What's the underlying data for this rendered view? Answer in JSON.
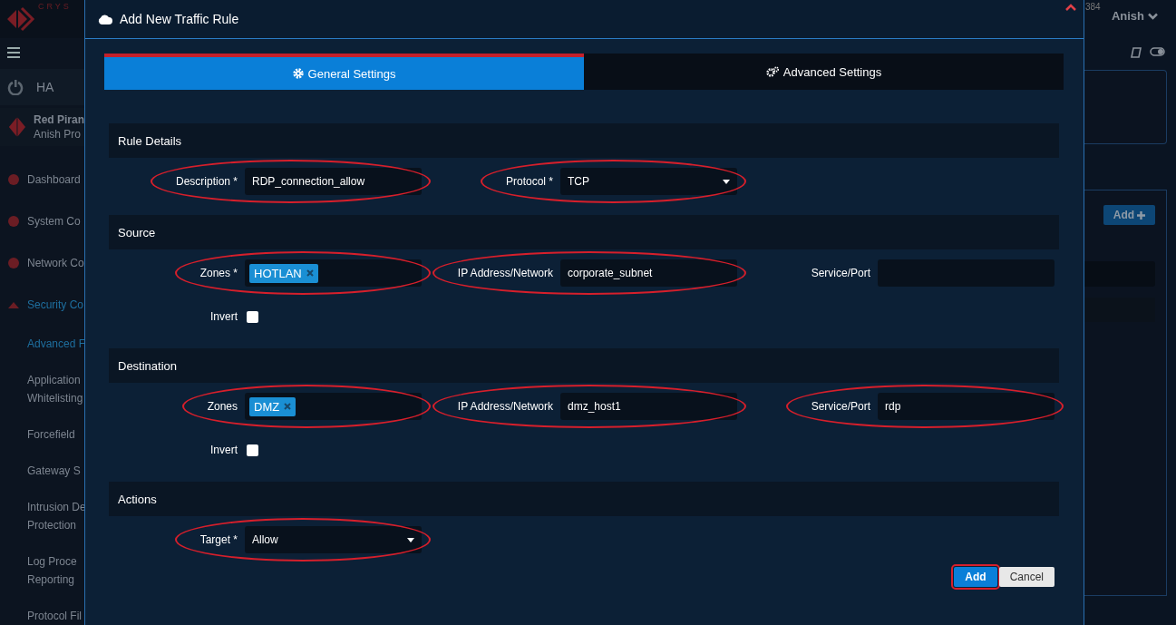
{
  "app": {
    "logo_text": "CRYS",
    "badge": "384",
    "user": "Anish",
    "background_button": "Add"
  },
  "sidebar": {
    "ha_label": "HA",
    "profile": {
      "name": "Red Piran",
      "subtitle": "Anish Pro"
    },
    "items": [
      {
        "label": "Dashboard",
        "kind": "main",
        "selected": false
      },
      {
        "label": "System Co",
        "kind": "main",
        "selected": false
      },
      {
        "label": "Network Co",
        "kind": "main",
        "selected": false
      },
      {
        "label": "Security Co",
        "kind": "main",
        "selected": true
      },
      {
        "label": "Advanced F",
        "kind": "sub",
        "selected": true
      },
      {
        "label": "Application",
        "label_2": "Whitelisting",
        "kind": "sub",
        "selected": false
      },
      {
        "label": "Forcefield",
        "kind": "sub",
        "selected": false
      },
      {
        "label": "Gateway S",
        "kind": "sub",
        "selected": false
      },
      {
        "label": "Intrusion De",
        "label_2": "Protection",
        "kind": "sub",
        "selected": false
      },
      {
        "label": "Log Proce",
        "label_2": "Reporting",
        "kind": "sub",
        "selected": false
      },
      {
        "label": "Protocol Fil",
        "kind": "sub",
        "selected": false
      }
    ]
  },
  "modal": {
    "title": "Add New Traffic Rule",
    "tabs": [
      {
        "label": "General Settings",
        "selected": true
      },
      {
        "label": "Advanced Settings",
        "selected": false
      }
    ],
    "sections": [
      {
        "title": "Rule Details",
        "rows": [
          {
            "fields": [
              {
                "label": "Description *",
                "kind": "text",
                "value": "RDP_connection_allow",
                "highlighted": true
              },
              {
                "label": "Protocol *",
                "kind": "select",
                "value": "TCP",
                "highlighted": true
              }
            ]
          }
        ]
      },
      {
        "title": "Source",
        "rows": [
          {
            "fields": [
              {
                "label": "Zones *",
                "kind": "tags",
                "tags": [
                  "HOTLAN"
                ],
                "highlighted": true
              },
              {
                "label": "IP Address/Network",
                "kind": "text",
                "value": "corporate_subnet",
                "highlighted": true
              },
              {
                "label": "Service/Port",
                "kind": "text",
                "highlighted": false
              }
            ]
          },
          {
            "fields": [
              {
                "label": "Invert",
                "kind": "checkbox",
                "checked": false,
                "highlighted": false
              }
            ]
          }
        ]
      },
      {
        "title": "Destination",
        "rows": [
          {
            "fields": [
              {
                "label": "Zones",
                "kind": "tags",
                "tags": [
                  "DMZ"
                ],
                "highlighted": true
              },
              {
                "label": "IP Address/Network",
                "kind": "text",
                "value": "dmz_host1",
                "highlighted": true
              },
              {
                "label": "Service/Port",
                "kind": "text",
                "value": "rdp",
                "highlighted": true
              }
            ]
          },
          {
            "fields": [
              {
                "label": "Invert",
                "kind": "checkbox",
                "checked": false,
                "highlighted": false
              }
            ]
          }
        ]
      },
      {
        "title": "Actions",
        "rows": [
          {
            "fields": [
              {
                "label": "Target *",
                "kind": "select",
                "value": "Allow",
                "highlighted": true
              }
            ]
          }
        ]
      }
    ],
    "buttons": [
      {
        "label": "Add",
        "kind": "primary",
        "highlighted": true
      },
      {
        "label": "Cancel",
        "kind": "secondary",
        "highlighted": false
      }
    ]
  }
}
